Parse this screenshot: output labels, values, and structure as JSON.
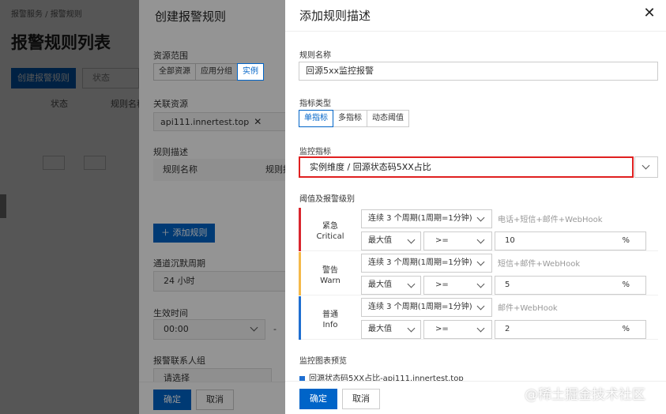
{
  "bg": {
    "breadcrumb": "报警服务  /  报警规则",
    "title": "报警规则列表",
    "create_button": "创建报警规则",
    "status_select": "状态",
    "col_status": "状态",
    "col_rule_name": "规则名称"
  },
  "drawer2": {
    "title": "创建报警规则",
    "resource_scope_label": "资源范围",
    "scope_options": [
      "全部资源",
      "应用分组",
      "实例"
    ],
    "scope_selected": "实例",
    "related_resource_label": "关联资源",
    "related_resource_tag": "api111.innertest.top",
    "rule_desc_label": "规则描述",
    "rule_name_col": "规则名称",
    "rule_desc_col": "规则描",
    "add_rule_button": "添加规则",
    "silence_label": "通道沉默周期",
    "silence_value": "24 小时",
    "effective_time_label": "生效时间",
    "effective_time_value": "00:00",
    "contact_group_label": "报警联系人组",
    "contact_group_value": "请选择",
    "ok_button": "确定",
    "cancel_button": "取消"
  },
  "drawer3": {
    "title": "添加规则描述",
    "rule_name_label": "规则名称",
    "rule_name_value": "回源5xx监控报警",
    "metric_type_label": "指标类型",
    "metric_type_options": [
      "单指标",
      "多指标",
      "动态阈值"
    ],
    "metric_type_selected": "单指标",
    "monitor_metric_label": "监控指标",
    "monitor_metric_value": "实例维度 / 回源状态码5XX占比",
    "threshold_label": "阈值及报警级别",
    "levels": [
      {
        "name": "紧急",
        "name_en": "Critical",
        "color": "#d9262e",
        "cycle": "连续 3 个周期(1周期=1分钟)",
        "notify": "电话+短信+邮件+WebHook",
        "stat": "最大值",
        "op": ">=",
        "value": "10",
        "unit": "%"
      },
      {
        "name": "警告",
        "name_en": "Warn",
        "color": "#f5b94a",
        "cycle": "连续 3 个周期(1周期=1分钟)",
        "notify": "短信+邮件+WebHook",
        "stat": "最大值",
        "op": ">=",
        "value": "5",
        "unit": "%"
      },
      {
        "name": "普通",
        "name_en": "Info",
        "color": "#1f6fd1",
        "cycle": "连续 3 个周期(1周期=1分钟)",
        "notify": "邮件+WebHook",
        "stat": "最大值",
        "op": ">=",
        "value": "2",
        "unit": "%"
      }
    ],
    "preview_label": "监控图表预览",
    "preview_series": "回源状态码5XX占比-api111.innertest.top",
    "ok_button": "确定",
    "cancel_button": "取消"
  },
  "watermark": "@稀土掘金技术社区"
}
